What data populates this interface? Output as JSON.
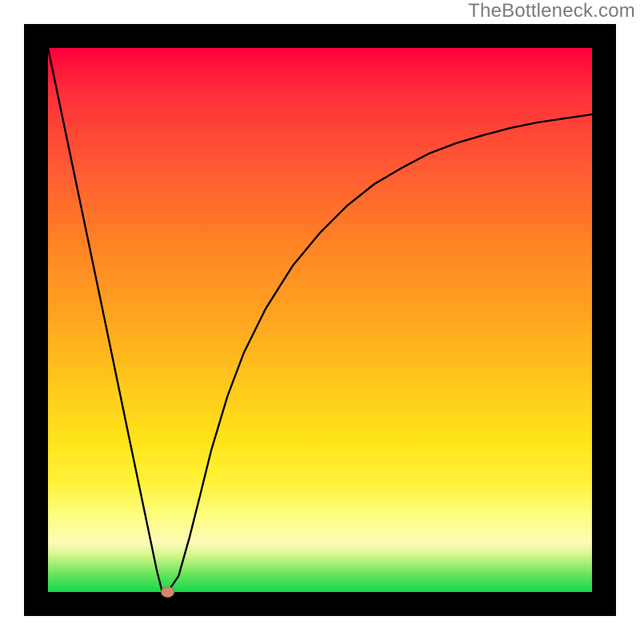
{
  "attribution": "TheBottleneck.com",
  "chart_data": {
    "type": "line",
    "title": "",
    "xlabel": "",
    "ylabel": "",
    "xlim": [
      0,
      100
    ],
    "ylim": [
      0,
      100
    ],
    "legend": false,
    "grid": false,
    "background": {
      "type": "vertical-gradient",
      "stops": [
        {
          "offset": 0,
          "color": "#ff003a"
        },
        {
          "offset": 50,
          "color": "#ffa61f"
        },
        {
          "offset": 80,
          "color": "#fff23a"
        },
        {
          "offset": 95,
          "color": "#9eee70"
        },
        {
          "offset": 100,
          "color": "#17d84d"
        }
      ]
    },
    "series": [
      {
        "name": "bottleneck-curve",
        "x": [
          0,
          5,
          10,
          15,
          20,
          21,
          22,
          24,
          26,
          28,
          30,
          33,
          36,
          40,
          45,
          50,
          55,
          60,
          65,
          70,
          75,
          80,
          85,
          90,
          95,
          100
        ],
        "values": [
          100,
          76,
          52,
          28,
          4,
          0,
          0,
          3,
          10,
          18,
          26,
          36,
          44,
          52,
          60,
          66,
          71,
          75,
          78,
          80.5,
          82.5,
          84,
          85.3,
          86.3,
          87.1,
          87.8
        ]
      }
    ],
    "marker": {
      "x": 22,
      "y": 0,
      "color": "#d08870"
    }
  }
}
